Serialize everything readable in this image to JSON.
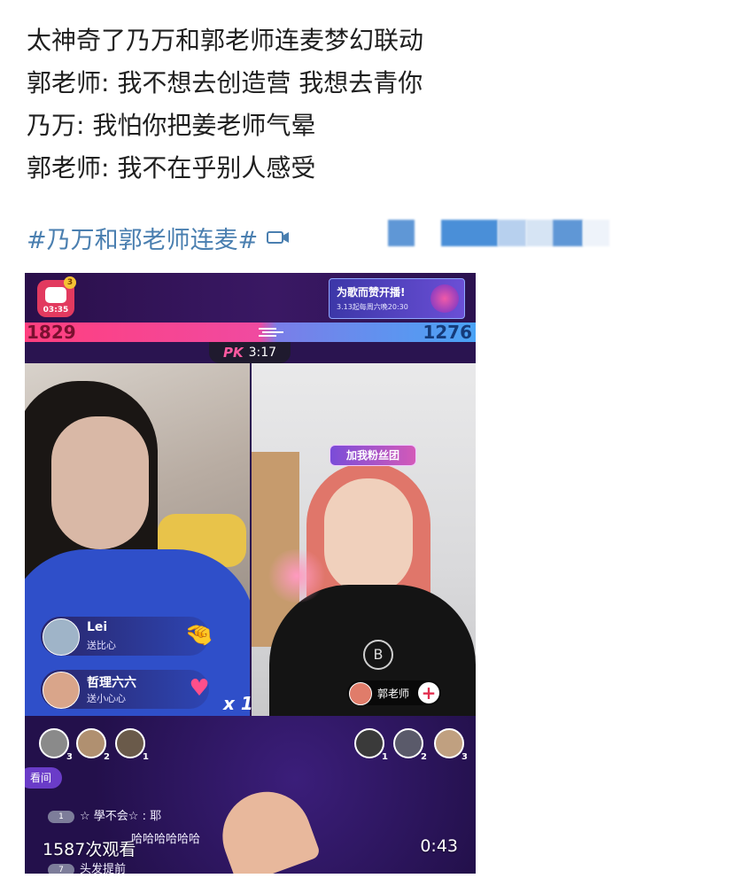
{
  "post": {
    "lines": [
      "太神奇了乃万和郭老师连麦梦幻联动",
      "郭老师: 我不想去创造营 我想去青你",
      "乃万: 我怕你把姜老师气晕",
      "郭老师: 我不在乎别人感受"
    ],
    "topic": "#乃万和郭老师连麦#"
  },
  "video": {
    "rec_time": "03:35",
    "rec_badge_count": "3",
    "promo_title": "为歌而赞开播!",
    "promo_subtitle": "3.13起每周六晚20:30",
    "pk": {
      "left_score": "1829",
      "right_score": "1276",
      "logo": "PK",
      "timer": "3:17",
      "left_score_color": "#ff3f7f",
      "right_score_color": "#4aa3f5"
    },
    "fan_tag": "加我粉丝团",
    "host": {
      "name": "郭老师",
      "follow": "+"
    },
    "gifts": [
      {
        "name": "Lei",
        "desc": "送比心",
        "item_icon": "hand-heart-icon"
      },
      {
        "name": "哲理六六",
        "desc": "送小心心",
        "item_icon": "heart-gift-icon"
      }
    ],
    "gift_multiplier": "x 1",
    "left_viewers": [
      "3",
      "2",
      "1"
    ],
    "right_viewers": [
      "1",
      "2",
      "3"
    ],
    "room_pill": "看间",
    "chat": [
      {
        "level": "1",
        "text": "☆ 學不会☆ : 耶"
      },
      {
        "level": "",
        "text": "哈哈哈哈哈哈"
      },
      {
        "level": "7",
        "text": "头发提前"
      }
    ],
    "views": "1587次观看",
    "duration": "0:43"
  }
}
